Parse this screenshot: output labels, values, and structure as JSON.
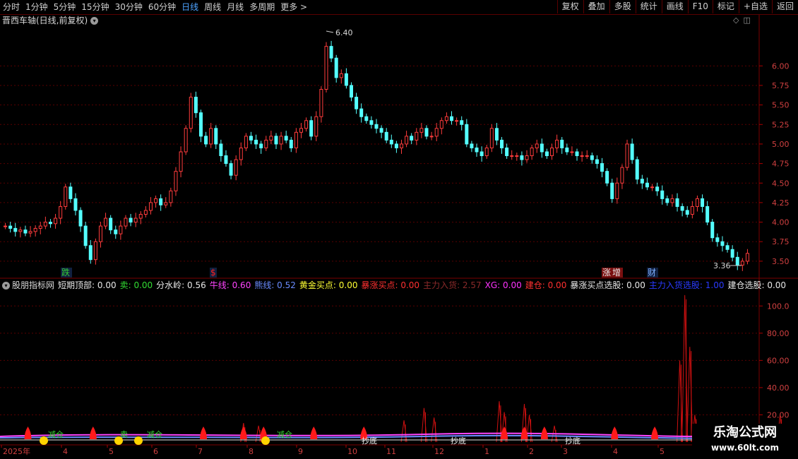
{
  "toolbar": {
    "periods": [
      "分时",
      "1分钟",
      "5分钟",
      "15分钟",
      "30分钟",
      "60分钟",
      "日线",
      "周线",
      "月线",
      "多周期",
      "更多 >"
    ],
    "active_period": "日线",
    "buttons": [
      "复权",
      "叠加",
      "多股",
      "统计",
      "画线",
      "F10",
      "标记",
      "+自选",
      "返回"
    ]
  },
  "price_panel": {
    "title": "晋西车轴(日线,前复权)",
    "high_label": "6.40",
    "low_label": "3.36",
    "y_ticks": [
      "6.00",
      "5.75",
      "5.50",
      "5.25",
      "5.00",
      "4.75",
      "4.50",
      "4.25",
      "4.00",
      "3.75",
      "3.50"
    ],
    "markers": [
      {
        "text": "跌",
        "color": "#33cc33"
      },
      {
        "text": "$",
        "color": "#ff2020"
      },
      {
        "text": "涨",
        "color": "#e8e8e8"
      },
      {
        "text": "增",
        "color": "#e8e8e8"
      },
      {
        "text": "财",
        "color": "#7fb0ff"
      }
    ]
  },
  "indicator_panel": {
    "name": "股朋指标网",
    "items": [
      {
        "label": "短期顶部: 0.00",
        "color": "#e8e8e8"
      },
      {
        "label": "卖: 0.00",
        "color": "#33dd33"
      },
      {
        "label": "分水岭: 0.56",
        "color": "#e8e8e8"
      },
      {
        "label": "牛线: 0.60",
        "color": "#ff44ff"
      },
      {
        "label": "熊线: 0.52",
        "color": "#6a8cff"
      },
      {
        "label": "黄金买点: 0.00",
        "color": "#ffff33"
      },
      {
        "label": "暴涨买点: 0.00",
        "color": "#ff3030"
      },
      {
        "label": "主力入货: 2.57",
        "color": "#8a2a2a"
      },
      {
        "label": "XG: 0.00",
        "color": "#ff33ff"
      },
      {
        "label": "建仓: 0.00",
        "color": "#ff3030"
      },
      {
        "label": "暴涨买点选股: 0.00",
        "color": "#e8e8e8"
      },
      {
        "label": "主力入货选股: 1.00",
        "color": "#2a3aff"
      },
      {
        "label": "建仓选股: 0.00",
        "color": "#e8e8e8"
      }
    ],
    "y_ticks": [
      "100.0",
      "80.00",
      "60.00",
      "40.00",
      "20.00"
    ],
    "signals": [
      "减仓",
      "卖",
      "减仓",
      "减仓",
      "抄底",
      "抄底",
      "抄底"
    ]
  },
  "time_axis": [
    "2025年",
    "4",
    "5",
    "6",
    "7",
    "8",
    "9",
    "10",
    "11",
    "12",
    "1",
    "2",
    "3",
    "4",
    "5"
  ],
  "watermark": {
    "line1": "乐淘公式网",
    "line2": "www.60lt.com"
  },
  "chart_data": {
    "type": "candlestick",
    "series_close": [
      3.95,
      3.92,
      3.88,
      3.9,
      3.86,
      3.88,
      3.92,
      3.95,
      4.0,
      3.98,
      4.05,
      4.2,
      4.45,
      4.3,
      4.15,
      3.95,
      3.7,
      3.52,
      3.75,
      3.95,
      4.05,
      3.9,
      3.85,
      3.95,
      4.05,
      4.0,
      4.05,
      4.1,
      4.15,
      4.25,
      4.3,
      4.22,
      4.25,
      4.4,
      4.65,
      4.9,
      5.2,
      5.6,
      5.4,
      5.1,
      5.0,
      5.2,
      5.0,
      4.85,
      4.75,
      4.6,
      4.8,
      4.95,
      5.1,
      5.05,
      5.0,
      4.95,
      5.05,
      5.1,
      5.0,
      5.1,
      5.05,
      4.95,
      5.15,
      5.2,
      5.3,
      5.1,
      5.35,
      5.7,
      6.25,
      6.1,
      5.85,
      5.9,
      5.75,
      5.6,
      5.45,
      5.35,
      5.3,
      5.25,
      5.2,
      5.15,
      5.05,
      5.0,
      4.95,
      5.0,
      5.1,
      5.05,
      5.15,
      5.2,
      5.1,
      5.1,
      5.2,
      5.3,
      5.35,
      5.3,
      5.3,
      5.25,
      5.0,
      4.95,
      4.9,
      4.85,
      4.95,
      5.2,
      5.05,
      4.95,
      4.85,
      4.85,
      4.85,
      4.8,
      4.85,
      4.95,
      5.0,
      4.9,
      4.85,
      4.95,
      5.05,
      4.95,
      4.9,
      4.9,
      4.85,
      4.85,
      4.85,
      4.8,
      4.75,
      4.65,
      4.5,
      4.3,
      4.5,
      4.7,
      5.0,
      4.8,
      4.55,
      4.5,
      4.45,
      4.45,
      4.4,
      4.3,
      4.25,
      4.3,
      4.2,
      4.15,
      4.1,
      4.2,
      4.3,
      4.2,
      4.0,
      3.8,
      3.75,
      3.7,
      3.65,
      3.55,
      3.45,
      3.5,
      3.6
    ],
    "price_range": [
      3.3,
      6.5
    ],
    "high": 6.4,
    "low": 3.36,
    "y_ticks": [
      6.0,
      5.75,
      5.5,
      5.25,
      5.0,
      4.75,
      4.5,
      4.25,
      4.0,
      3.75,
      3.5
    ],
    "indicator_main": [
      0,
      0,
      0,
      0,
      0,
      0,
      0,
      0,
      0,
      0,
      0,
      0,
      0,
      0,
      0,
      0,
      0,
      0,
      0,
      0,
      0,
      0,
      0,
      0,
      0,
      0,
      0,
      0,
      0,
      0,
      0,
      0,
      0,
      0,
      0,
      0,
      0,
      0,
      0,
      0,
      0,
      0,
      0,
      0,
      0,
      0,
      0,
      0,
      0,
      0,
      0,
      0,
      0,
      0,
      0,
      0,
      0,
      0,
      0,
      0,
      0,
      0,
      0,
      0,
      0,
      0,
      0,
      0,
      0,
      0,
      0,
      0,
      0,
      0,
      0,
      0,
      0,
      0,
      0,
      0,
      0,
      0,
      0,
      0,
      0,
      0,
      0,
      0,
      0,
      0,
      0,
      0,
      0,
      0,
      0,
      0,
      0,
      0,
      0,
      0,
      0,
      0,
      0,
      0,
      0,
      0,
      0,
      0,
      0,
      0,
      0,
      0,
      0,
      0,
      0,
      0,
      0,
      0,
      0,
      0,
      0,
      0,
      0,
      0,
      0,
      0,
      0,
      0,
      0,
      0,
      0,
      0,
      0,
      0,
      0,
      0,
      0,
      0,
      0,
      0,
      0,
      0,
      0,
      0,
      0,
      0,
      0,
      0,
      0
    ],
    "indicator_range": [
      0,
      110
    ],
    "indicator_ticks": [
      100,
      80,
      60,
      40,
      20
    ],
    "indicator_peaks": [
      {
        "i": 48,
        "v": 14
      },
      {
        "i": 51,
        "v": 12
      },
      {
        "i": 80,
        "v": 16
      },
      {
        "i": 84,
        "v": 25
      },
      {
        "i": 86,
        "v": 18
      },
      {
        "i": 99,
        "v": 30
      },
      {
        "i": 100,
        "v": 22
      },
      {
        "i": 104,
        "v": 28
      },
      {
        "i": 105,
        "v": 20
      },
      {
        "i": 110,
        "v": 12
      },
      {
        "i": 135,
        "v": 60
      },
      {
        "i": 136,
        "v": 108
      },
      {
        "i": 137,
        "v": 70
      },
      {
        "i": 138,
        "v": 20
      },
      {
        "i": 155,
        "v": 20
      },
      {
        "i": 160,
        "v": 22
      },
      {
        "i": 164,
        "v": 20
      }
    ],
    "flame_positions": [
      5,
      18,
      40,
      48,
      52,
      62,
      72,
      100,
      104,
      108,
      122,
      130,
      140,
      146,
      158,
      168,
      174
    ]
  }
}
